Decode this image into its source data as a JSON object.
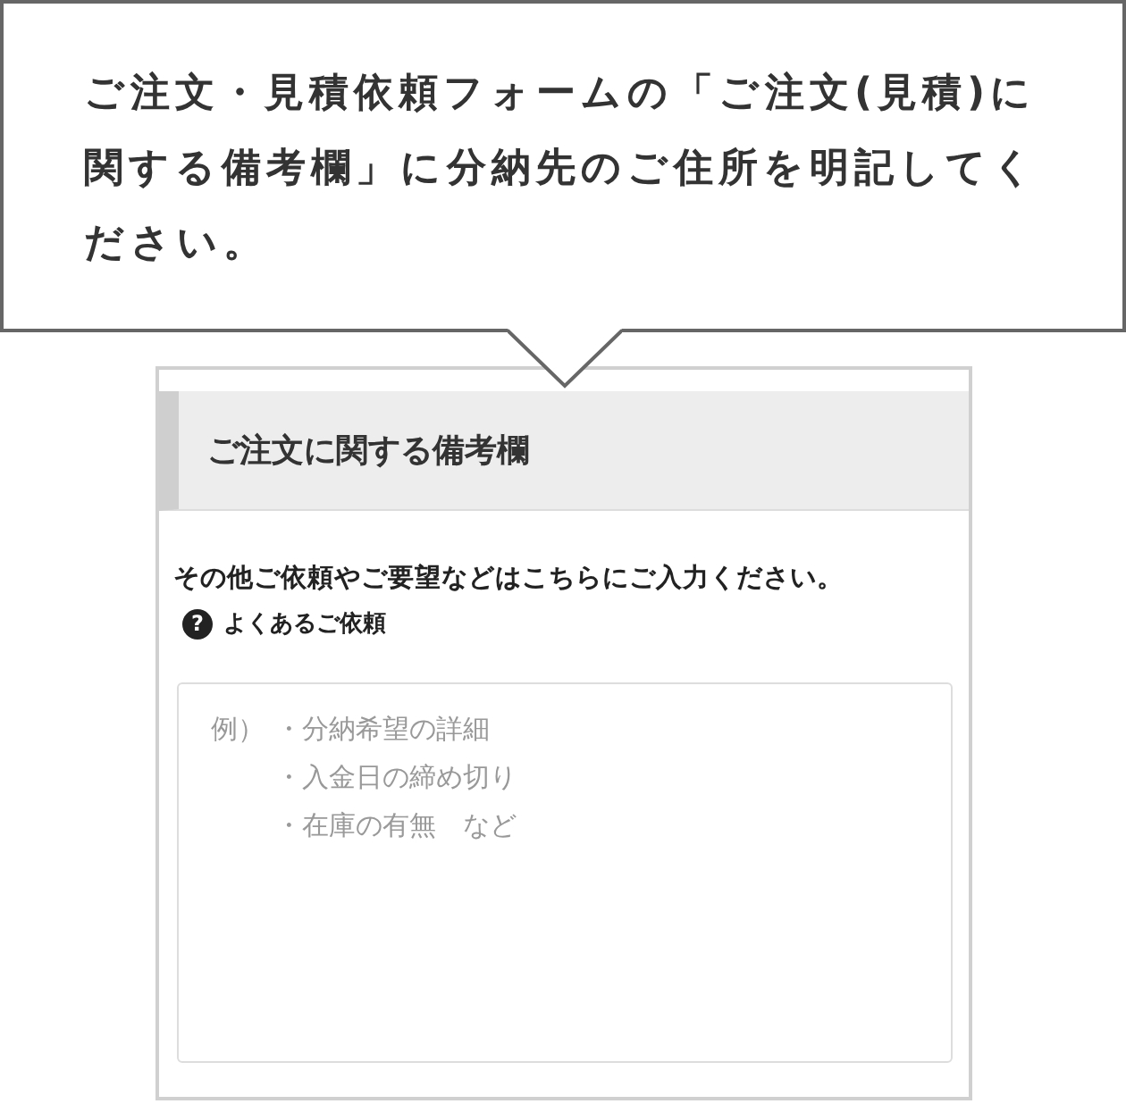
{
  "callout": {
    "text": "ご注文・見積依頼フォームの「ご注文(見積)に関する備考欄」に分納先のご住所を明記してください。"
  },
  "panel": {
    "heading": "ご注文に関する備考欄",
    "description": "その他ご依頼やご要望などはこちらにご入力ください。",
    "help_link": "よくあるご依頼",
    "help_icon": "?",
    "remarks": {
      "placeholder_lines": [
        {
          "label": "例）",
          "text": "・分納希望の詳細"
        },
        {
          "text": "・入金日の締め切り"
        },
        {
          "text": "・在庫の有無　など"
        }
      ]
    }
  }
}
